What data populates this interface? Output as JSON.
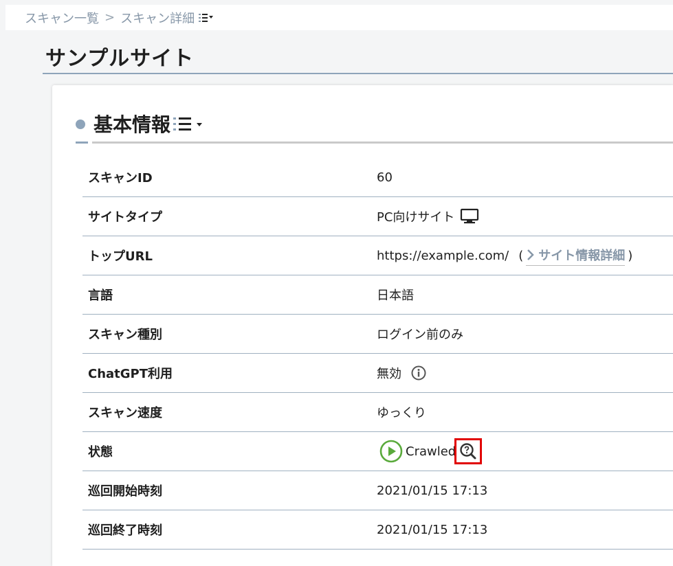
{
  "breadcrumb": {
    "items": [
      "スキャン一覧",
      "スキャン詳細"
    ],
    "separator": ">"
  },
  "page": {
    "title": "サンプルサイト"
  },
  "section": {
    "title": "基本情報"
  },
  "rows": [
    {
      "label": "スキャンID",
      "value": "60"
    },
    {
      "label": "サイトタイプ",
      "value": "PC向けサイト",
      "icon": "monitor-icon"
    },
    {
      "label": "トップURL",
      "value": "https://example.com/",
      "link_label": "サイト情報詳細",
      "open_paren": "(",
      "close_paren": ")"
    },
    {
      "label": "言語",
      "value": "日本語"
    },
    {
      "label": "スキャン種別",
      "value": "ログイン前のみ"
    },
    {
      "label": "ChatGPT利用",
      "value": "無効",
      "icon": "info-icon"
    },
    {
      "label": "スキャン速度",
      "value": "ゆっくり"
    },
    {
      "label": "状態",
      "value": "Crawled",
      "icon": "play-circle-icon",
      "action_icon": "search-help-icon"
    },
    {
      "label": "巡回開始時刻",
      "value": "2021/01/15 17:13"
    },
    {
      "label": "巡回終了時刻",
      "value": "2021/01/15 17:13"
    }
  ],
  "colors": {
    "accent": "#8ea4ba",
    "status_green": "#5aaa3c",
    "highlight": "#e10000"
  }
}
